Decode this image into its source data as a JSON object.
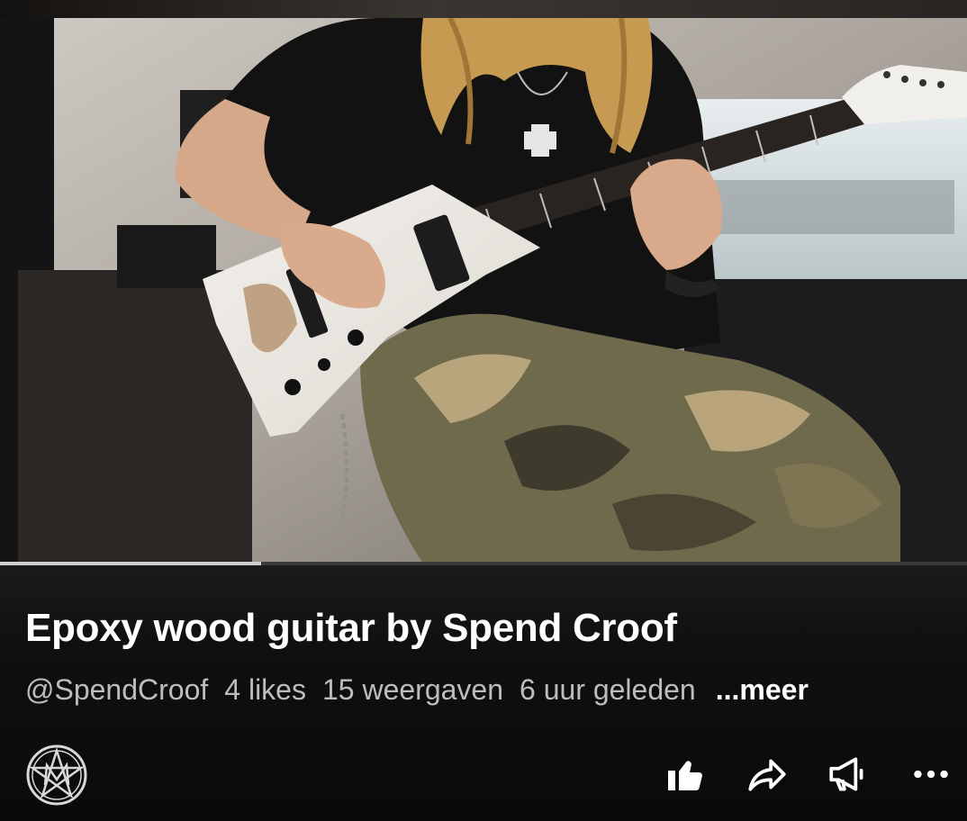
{
  "video": {
    "title": "Epoxy wood guitar by Spend Croof",
    "progress_percent": 27
  },
  "meta": {
    "channel_handle": "@SpendCroof",
    "likes": "4 likes",
    "views": "15 weergaven",
    "age": "6 uur geleden",
    "more_label": "...meer"
  },
  "actions": [
    {
      "icon": "thumbs-up-icon"
    },
    {
      "icon": "share-icon"
    },
    {
      "icon": "megaphone-icon"
    },
    {
      "icon": "more-options-icon"
    }
  ],
  "colors": {
    "title": "#ffffff",
    "meta_text": "#bdbdbd",
    "background": "#0a0a0a"
  }
}
